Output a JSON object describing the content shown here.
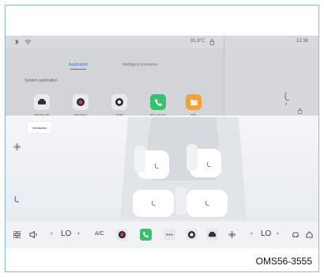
{
  "status_bar": {
    "temperature": "81.8°C",
    "clock": "12:38"
  },
  "launcher": {
    "tabs": [
      {
        "label": "Application",
        "active": true
      },
      {
        "label": "Intelligent scenarios",
        "active": false
      }
    ],
    "section_title": "System application",
    "apps": [
      {
        "label": "Bluetooth",
        "icon": "car-icon",
        "color": "#e9eaee"
      },
      {
        "label": "Medium",
        "icon": "record-icon",
        "color": "#e9eaee"
      },
      {
        "label": "AVM",
        "icon": "camera-icon",
        "color": "#e9eaee"
      },
      {
        "label": "BT phone",
        "icon": "phone-icon",
        "color": "#34c26b"
      },
      {
        "label": "File",
        "icon": "folder-icon",
        "color": "#f3a23a"
      }
    ]
  },
  "ventilation": {
    "title": "Ventilation"
  },
  "bottom_bar": {
    "left_temp": "LO",
    "right_temp": "LO",
    "ac_label": "A/C",
    "left_arrow": "‹",
    "right_arrow": "›"
  },
  "watermark": "OMS56-3555",
  "colors": {
    "accent": "#3c6fe0",
    "phone_green": "#34c26b",
    "folder_orange": "#f3a23a"
  }
}
